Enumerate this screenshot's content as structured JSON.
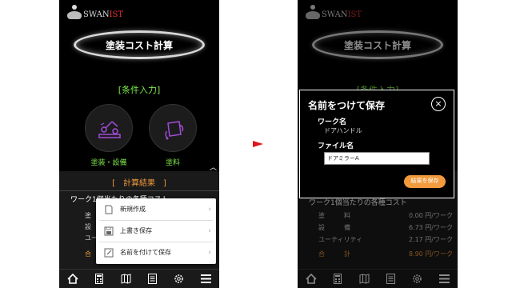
{
  "app": {
    "logo_main": "SWAN",
    "logo_accent": "IST",
    "title": "塗装コスト計算"
  },
  "conditions": {
    "heading": "[条件入力]",
    "paint_equipment": "塗装・設備",
    "paint": "塗料"
  },
  "results": {
    "heading": "[　計算結果　]",
    "subheading": "ワーク1個当たりの各種コスト",
    "rows": [
      {
        "label": "塗　　　料",
        "value": "0.00 円/ワーク"
      },
      {
        "label": "設　　　備",
        "value": "6.73 円/ワーク"
      },
      {
        "label": "ユーティリティ",
        "value": "2.17 円/ワーク"
      }
    ],
    "total_label": "合　　　計",
    "total_value": "8.90 円/ワーク"
  },
  "left_partial": {
    "subheading": "ワーク1個当たりの各種コスト",
    "row_labels": [
      "塗",
      "設",
      "ユー"
    ],
    "total_label": "合"
  },
  "menu": {
    "items": [
      {
        "label": "新規作成",
        "icon": "new-document-icon"
      },
      {
        "label": "上書き保存",
        "icon": "save-icon"
      },
      {
        "label": "名前を付けて保存",
        "icon": "save-as-icon"
      }
    ]
  },
  "dialog": {
    "title": "名前をつけて保存",
    "work_label": "ワーク名",
    "work_value": "ドアハンドル",
    "file_label": "ファイル名",
    "file_value": "ドアミラーA",
    "save_button": "結果を保存"
  },
  "colors": {
    "accent_green": "#7fe84a",
    "accent_orange": "#f19a3e",
    "arrow_red": "#e0141e",
    "paint_purple": "#a14cd8"
  },
  "nav_icons": [
    "home-icon",
    "calculator-icon",
    "map-icon",
    "document-icon",
    "settings-icon",
    "menu-icon"
  ]
}
